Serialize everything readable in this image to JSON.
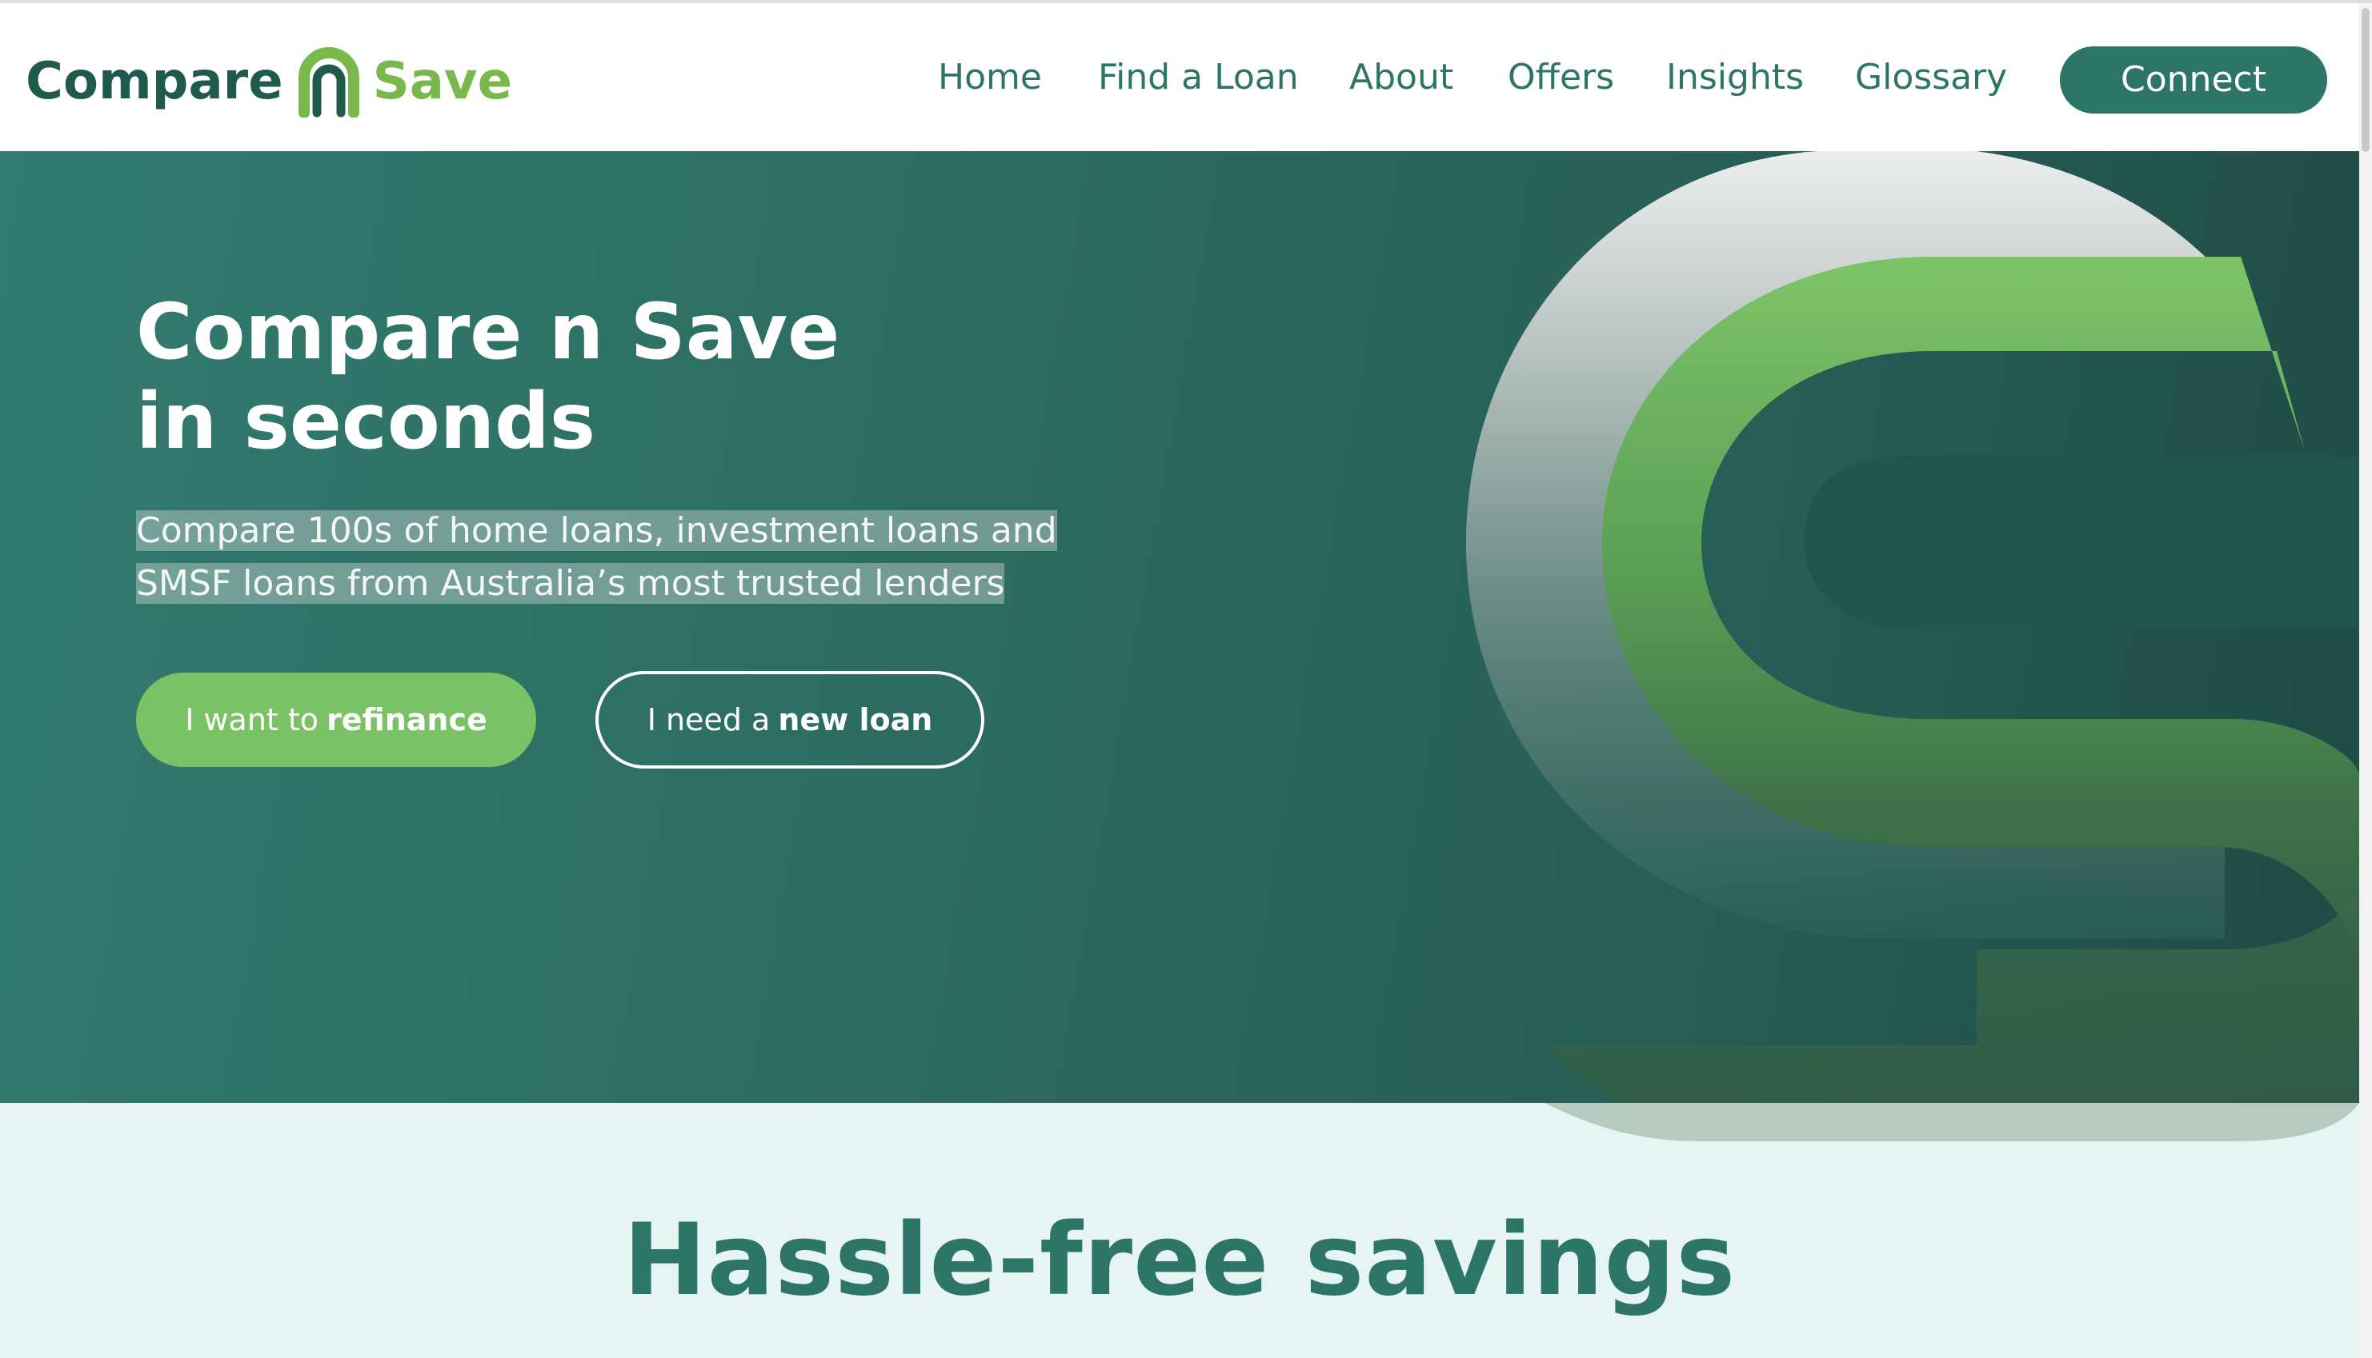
{
  "header": {
    "logo": {
      "left": "Compare",
      "right": "Save"
    },
    "nav": [
      {
        "label": "Home"
      },
      {
        "label": "Find a Loan"
      },
      {
        "label": "About"
      },
      {
        "label": "Offers"
      },
      {
        "label": "Insights"
      },
      {
        "label": "Glossary"
      }
    ],
    "cta": "Connect"
  },
  "hero": {
    "title_line1": "Compare n Save",
    "title_line2": "in seconds",
    "subtitle": "Compare 100s of home loans, investment loans and SMSF loans from Australia’s most trusted lenders",
    "button_refinance": {
      "prefix": "I want to",
      "bold": "refinance"
    },
    "button_new_loan": {
      "prefix": "I need a",
      "bold": "new loan"
    }
  },
  "section": {
    "title": "Hassle-free savings"
  },
  "colors": {
    "brand_dark": "#1f5a4d",
    "brand_teal": "#2d7566",
    "brand_green": "#79c266",
    "section_bg": "#e6f4f3"
  }
}
